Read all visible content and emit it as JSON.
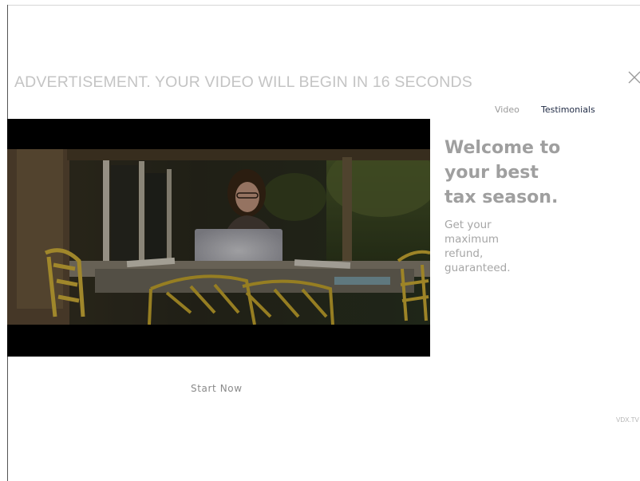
{
  "ad": {
    "banner_text": "ADVERTISEMENT. YOUR VIDEO WILL BEGIN IN 16 SECONDS",
    "countdown_seconds": 16
  },
  "tabs": [
    {
      "label": "Video",
      "active": false
    },
    {
      "label": "Testimonials",
      "active": true
    }
  ],
  "promo": {
    "headline_lines": [
      "Welcome to",
      "your best",
      "tax season."
    ],
    "subtext_lines": [
      "Get your",
      "maximum",
      "refund,",
      "guaranteed."
    ]
  },
  "cta": {
    "label": "Start Now"
  },
  "brand": {
    "label": "VDX.TV"
  },
  "icons": {
    "close": "close-icon"
  },
  "colors": {
    "banner_text": "#c4c4c4",
    "headline": "#9f9f9f",
    "active_tab": "#1f2a44",
    "player_background": "#000000"
  }
}
